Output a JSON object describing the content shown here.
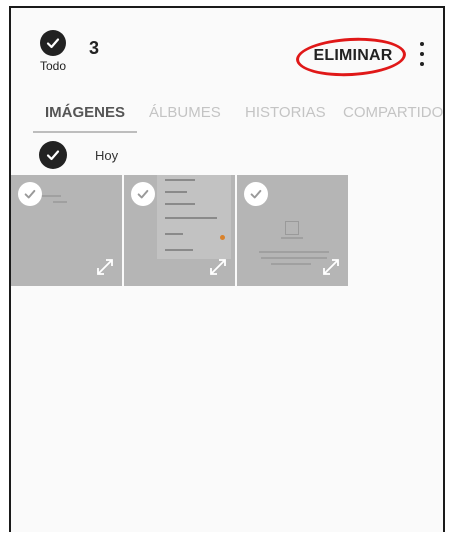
{
  "header": {
    "select_all_label": "Todo",
    "selected_count": "3",
    "delete_label": "ELIMINAR"
  },
  "tabs": [
    {
      "label": "IMÁGENES",
      "active": true
    },
    {
      "label": "ÁLBUMES",
      "active": false
    },
    {
      "label": "HISTORIAS",
      "active": false
    },
    {
      "label": "COMPARTIDO",
      "active": false
    }
  ],
  "group": {
    "label": "Hoy"
  },
  "colors": {
    "annotation_ring": "#e01818",
    "check_dark": "#222222",
    "thumb_bg": "#b5b5b5",
    "tab_inactive": "#c4c4c4"
  },
  "icons": {
    "select_all": "check-circle-icon",
    "more": "more-vertical-icon",
    "thumb_check": "check-icon",
    "expand": "expand-icon"
  }
}
